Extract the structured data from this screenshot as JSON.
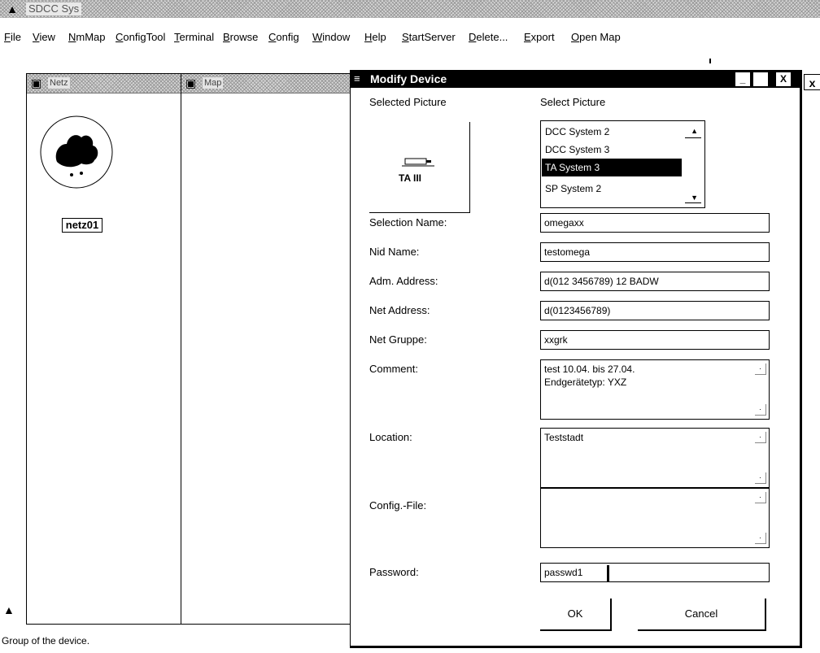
{
  "app": {
    "title": "SDCC Sys"
  },
  "menu": [
    "File",
    "View",
    "NmMap",
    "ConfigTool",
    "Terminal",
    "Browse",
    "Config",
    "Window",
    "Help",
    "StartServer",
    "Delete...",
    "Export",
    "Open Map"
  ],
  "windows": {
    "net": {
      "title": "Netz",
      "node_label": "netz01"
    },
    "map": {
      "title": "Map"
    }
  },
  "dialog": {
    "title": "Modify Device",
    "selected_picture_label": "Selected Picture",
    "select_picture_label": "Select Picture",
    "picture_caption": "TA III",
    "picture_options": [
      "DCC System 2",
      "DCC System 3",
      "TA System 3",
      "SP System 2"
    ],
    "picture_selected": "TA System 3",
    "fields": {
      "selection_name": {
        "label": "Selection Name:",
        "value": "omegaxx"
      },
      "nid_name": {
        "label": "Nid Name:",
        "value": "testomega"
      },
      "adm_address": {
        "label": "Adm. Address:",
        "value": "d(012 3456789) 12 BADW"
      },
      "net_address": {
        "label": "Net Address:",
        "value": "d(0123456789)"
      },
      "net_gruppe": {
        "label": "Net Gruppe:",
        "value": "xxgrk"
      },
      "comment": {
        "label": "Comment:",
        "line1": "test 10.04. bis 27.04.",
        "line2": "Endgerätetyp: YXZ"
      },
      "location": {
        "label": "Location:",
        "value": "Teststadt"
      },
      "config_file": {
        "label": "Config.-File:",
        "value": ""
      },
      "password": {
        "label": "Password:",
        "value": "passwd1"
      }
    },
    "buttons": {
      "ok": "OK",
      "cancel": "Cancel"
    },
    "controls": {
      "minimize": "_",
      "maximize": "",
      "close": "X"
    }
  },
  "status": {
    "text": "Group of the device."
  },
  "icons": [
    "app-logo-icon",
    "net-window-icon",
    "map-window-icon",
    "network-cloud-icon",
    "device-picture-icon",
    "tool-icon",
    "dialog-menu-icon"
  ]
}
